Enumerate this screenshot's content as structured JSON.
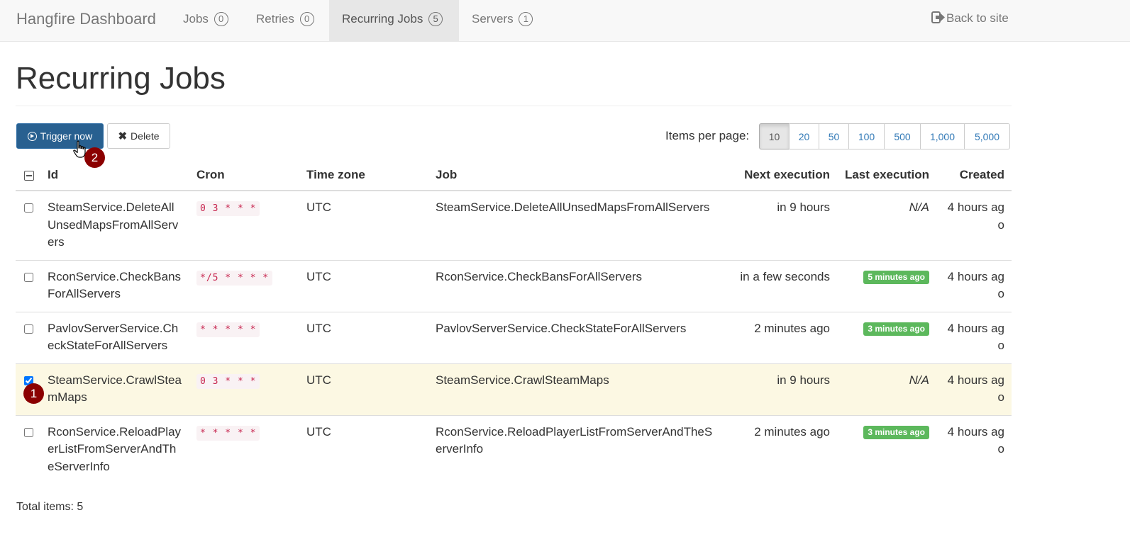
{
  "navbar": {
    "brand": "Hangfire Dashboard",
    "items": [
      {
        "label": "Jobs",
        "count": "0",
        "active": false
      },
      {
        "label": "Retries",
        "count": "0",
        "active": false
      },
      {
        "label": "Recurring Jobs",
        "count": "5",
        "active": true
      },
      {
        "label": "Servers",
        "count": "1",
        "active": false
      }
    ],
    "back_label": "Back to site"
  },
  "page": {
    "title": "Recurring Jobs"
  },
  "toolbar": {
    "trigger_label": "Trigger now",
    "delete_label": "Delete",
    "items_per_page_label": "Items per page:",
    "page_sizes": [
      "10",
      "20",
      "50",
      "100",
      "500",
      "1,000",
      "5,000"
    ],
    "selected_page_size": "10"
  },
  "table": {
    "headers": {
      "id": "Id",
      "cron": "Cron",
      "timezone": "Time zone",
      "job": "Job",
      "next": "Next execution",
      "last": "Last execution",
      "created": "Created"
    },
    "rows": [
      {
        "checked": false,
        "id": "SteamService.DeleteAllUnsedMapsFromAllServers",
        "cron": "0 3 * * *",
        "timezone": "UTC",
        "job": "SteamService.DeleteAllUnsedMapsFromAllServers",
        "next": "in 9 hours",
        "last": "N/A",
        "last_badge": false,
        "created": "4 hours ago"
      },
      {
        "checked": false,
        "id": "RconService.CheckBansForAllServers",
        "cron": "*/5 * * * *",
        "timezone": "UTC",
        "job": "RconService.CheckBansForAllServers",
        "next": "in a few seconds",
        "last": "5 minutes ago",
        "last_badge": true,
        "created": "4 hours ago"
      },
      {
        "checked": false,
        "id": "PavlovServerService.CheckStateForAllServers",
        "cron": "* * * * *",
        "timezone": "UTC",
        "job": "PavlovServerService.CheckStateForAllServers",
        "next": "2 minutes ago",
        "last": "3 minutes ago",
        "last_badge": true,
        "created": "4 hours ago"
      },
      {
        "checked": true,
        "id": "SteamService.CrawlSteamMaps",
        "cron": "0 3 * * *",
        "timezone": "UTC",
        "job": "SteamService.CrawlSteamMaps",
        "next": "in 9 hours",
        "last": "N/A",
        "last_badge": false,
        "created": "4 hours ago"
      },
      {
        "checked": false,
        "id": "RconService.ReloadPlayerListFromServerAndTheServerInfo",
        "cron": "* * * * *",
        "timezone": "UTC",
        "job": "RconService.ReloadPlayerListFromServerAndTheServerInfo",
        "next": "2 minutes ago",
        "last": "3 minutes ago",
        "last_badge": true,
        "created": "4 hours ago"
      }
    ]
  },
  "footer": {
    "total_label": "Total items: 5"
  },
  "markers": {
    "step1": "1",
    "step2": "2"
  },
  "colors": {
    "primary": "#286090",
    "success": "#5cb85c",
    "marker": "#8b0000",
    "selected_row": "#fcf8e3"
  }
}
